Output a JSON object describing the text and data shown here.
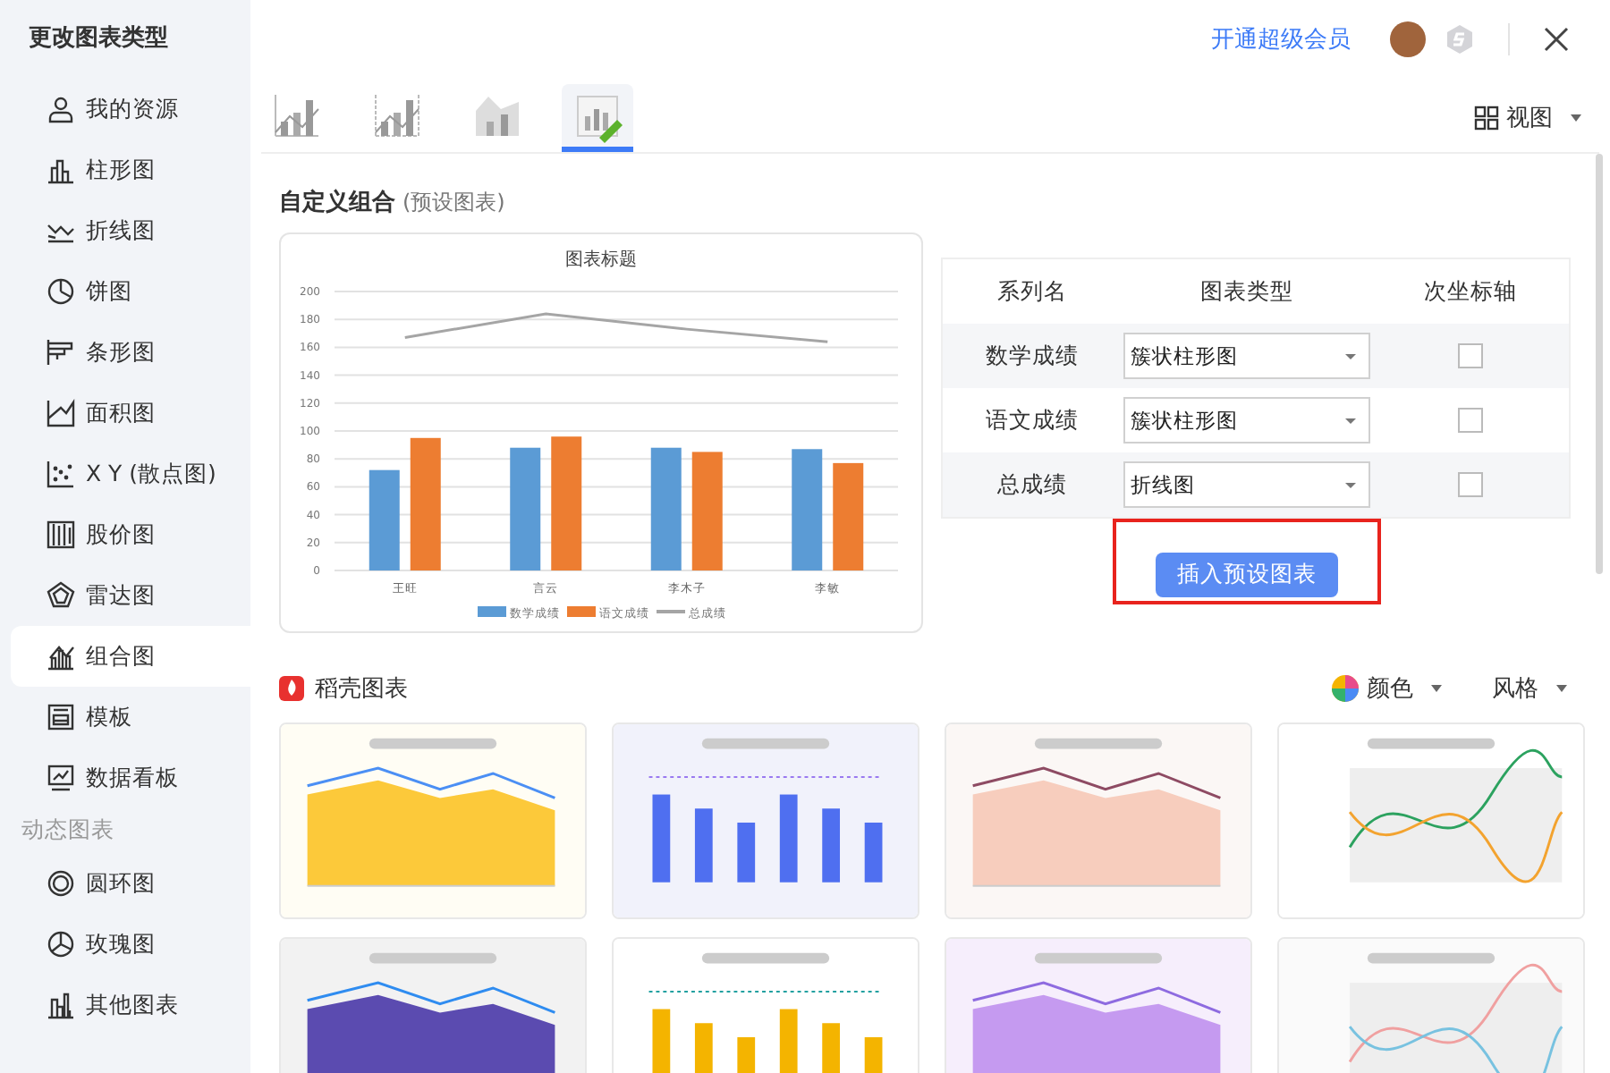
{
  "sidebar": {
    "title": "更改图表类型",
    "items": [
      {
        "label": "我的资源",
        "selected": false
      },
      {
        "label": "柱形图",
        "selected": false
      },
      {
        "label": "折线图",
        "selected": false
      },
      {
        "label": "饼图",
        "selected": false
      },
      {
        "label": "条形图",
        "selected": false
      },
      {
        "label": "面积图",
        "selected": false
      },
      {
        "label": "X Y (散点图)",
        "selected": false
      },
      {
        "label": "股价图",
        "selected": false
      },
      {
        "label": "雷达图",
        "selected": false
      },
      {
        "label": "组合图",
        "selected": true
      },
      {
        "label": "模板",
        "selected": false
      },
      {
        "label": "数据看板",
        "selected": false
      }
    ],
    "section_title": "动态图表",
    "dynamic_items": [
      {
        "label": "圆环图",
        "selected": false
      },
      {
        "label": "玫瑰图",
        "selected": false
      },
      {
        "label": "其他图表",
        "selected": false
      }
    ]
  },
  "header": {
    "vip_link": "开通超级会员"
  },
  "tabs": [
    {
      "selected": false
    },
    {
      "selected": false
    },
    {
      "selected": false
    },
    {
      "selected": true
    }
  ],
  "view_button": {
    "label": "视图"
  },
  "custom_section": {
    "title": "自定义组合",
    "subtitle": "(预设图表)"
  },
  "preview_chart": {
    "chart_data": {
      "type": "bar",
      "title": "图表标题",
      "categories": [
        "王旺",
        "言云",
        "李木子",
        "李敏"
      ],
      "series": [
        {
          "name": "数学成绩",
          "color": "#5b9bd5",
          "type": "bar",
          "values": [
            72,
            88,
            88,
            87
          ]
        },
        {
          "name": "语文成绩",
          "color": "#ed7d31",
          "type": "bar",
          "values": [
            95,
            96,
            85,
            77
          ]
        },
        {
          "name": "总成绩",
          "color": "#a5a5a5",
          "type": "line",
          "values": [
            167,
            184,
            173,
            164
          ]
        }
      ],
      "stacked": false,
      "grid": true,
      "legend": "bottom",
      "ylim": [
        0,
        200
      ],
      "yticks": [
        0,
        20,
        40,
        60,
        80,
        100,
        120,
        140,
        160,
        180,
        200
      ]
    }
  },
  "series_table": {
    "columns": [
      "系列名",
      "图表类型",
      "次坐标轴"
    ],
    "rows": [
      {
        "name": "数学成绩",
        "chart_type": "簇状柱形图",
        "secondary_axis": false
      },
      {
        "name": "语文成绩",
        "chart_type": "簇状柱形图",
        "secondary_axis": false
      },
      {
        "name": "总成绩",
        "chart_type": "折线图",
        "secondary_axis": false
      }
    ]
  },
  "insert_button": {
    "label": "插入预设图表",
    "highlighted": true
  },
  "templates": {
    "title": "稻壳图表",
    "color_button": "颜色",
    "style_button": "风格"
  }
}
